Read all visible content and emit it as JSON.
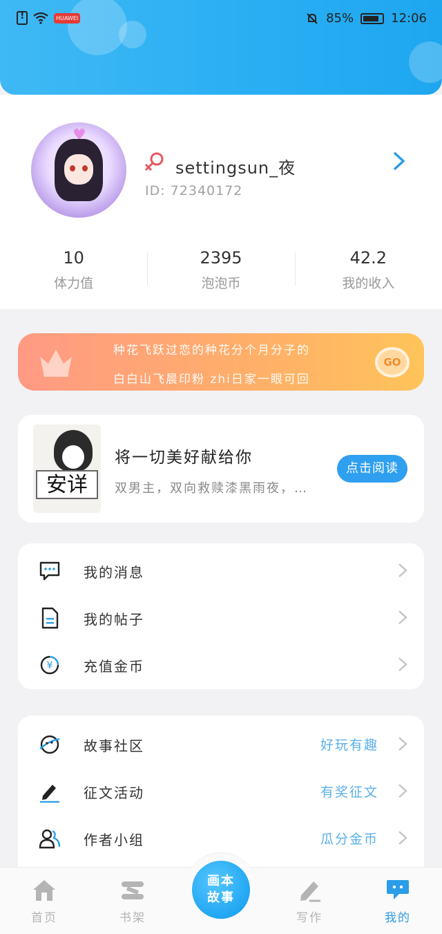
{
  "status_bar": {
    "app_badge": "HUAWEI",
    "battery_percent": "85%",
    "time": "12:06"
  },
  "profile": {
    "username": "settingsun_夜",
    "user_id": "ID: 72340172",
    "gender_icon": "female-symbol-icon",
    "accent_color": "#e8575d"
  },
  "stats": [
    {
      "value": "10",
      "label": "体力值"
    },
    {
      "value": "2395",
      "label": "泡泡币"
    },
    {
      "value": "42.2",
      "label": "我的收入"
    }
  ],
  "vip_banner": {
    "line1": "种花飞跃过恋的种花分个月分子的",
    "line2": "白白山飞晨印粉 zhi日家一眼可回",
    "go_label": "GO"
  },
  "book": {
    "cover_text": "安详",
    "title": "将一切美好献给你",
    "description": "双男主，双向救赎漆黑雨夜，…",
    "read_label": "点击阅读"
  },
  "menu_group_1": [
    {
      "label": "我的消息",
      "icon": "message-icon"
    },
    {
      "label": "我的帖子",
      "icon": "document-icon"
    },
    {
      "label": "充值金币",
      "icon": "coin-icon"
    }
  ],
  "menu_group_2": [
    {
      "label": "故事社区",
      "tag": "好玩有趣",
      "icon": "planet-icon"
    },
    {
      "label": "征文活动",
      "tag": "有奖征文",
      "icon": "pen-icon"
    },
    {
      "label": "作者小组",
      "tag": "瓜分金币",
      "icon": "users-icon"
    }
  ],
  "bottom_nav": {
    "home": "首页",
    "bookshelf": "书架",
    "center_line1": "画本",
    "center_line2": "故事",
    "write": "写作",
    "mine": "我的"
  },
  "colors": {
    "brand_blue": "#2a9de8",
    "tag_blue": "#5ab0e8",
    "vip_orange": "#ffb068"
  }
}
